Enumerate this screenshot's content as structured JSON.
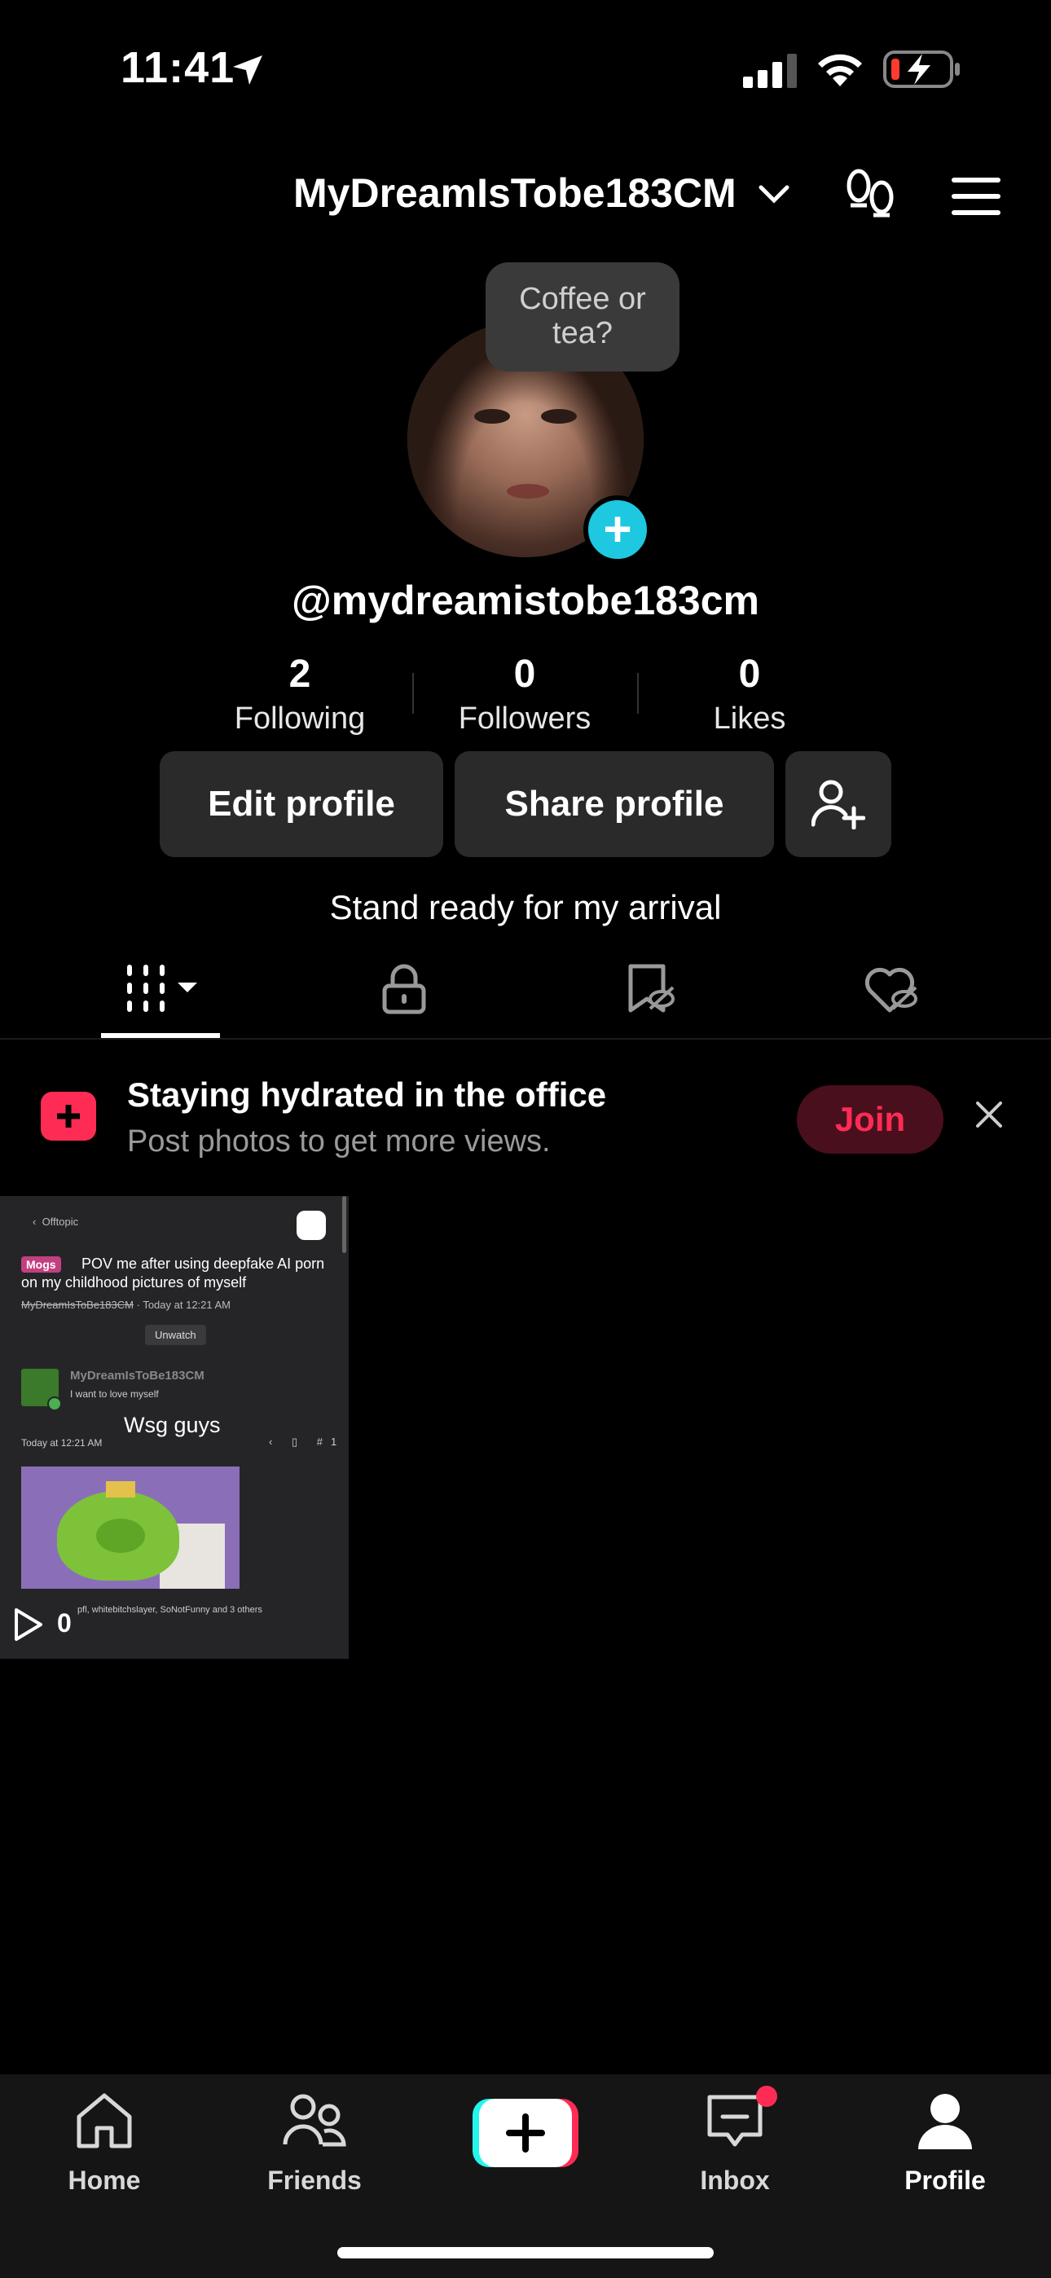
{
  "status_bar": {
    "time": "11:41"
  },
  "header": {
    "username": "MyDreamIsTobe183CM"
  },
  "profile": {
    "bubble_text": "Coffee or tea?",
    "handle": "@mydreamistobe183cm",
    "stats": [
      {
        "value": "2",
        "label": "Following"
      },
      {
        "value": "0",
        "label": "Followers"
      },
      {
        "value": "0",
        "label": "Likes"
      }
    ],
    "edit_label": "Edit profile",
    "share_label": "Share profile",
    "bio": "Stand ready for my arrival"
  },
  "banner": {
    "title": "Staying hydrated in the office",
    "subtitle": "Post photos to get more views.",
    "join_label": "Join"
  },
  "video": {
    "back_label": "Offtopic",
    "tag": "Mogs",
    "title": "POV me after using deepfake AI porn on my childhood pictures of myself",
    "meta_user": "MyDreamIsToBe183CM",
    "meta_time": "Today at 12:21 AM",
    "unwatch": "Unwatch",
    "post_user": "MyDreamIsToBe183CM",
    "post_status": "I want to love myself",
    "post_time": "Today at 12:21 AM",
    "post_number": "#1",
    "post_text": "Wsg guys",
    "reactions": "pfl, whitebitchslayer, SoNotFunny and 3 others",
    "views": "0"
  },
  "nav": {
    "items": [
      {
        "label": "Home"
      },
      {
        "label": "Friends"
      },
      {
        "label": "Inbox"
      },
      {
        "label": "Profile"
      }
    ]
  },
  "colors": {
    "accent": "#fe2c55",
    "cyan": "#25f4ee",
    "avatar_add": "#1ec8e0"
  }
}
